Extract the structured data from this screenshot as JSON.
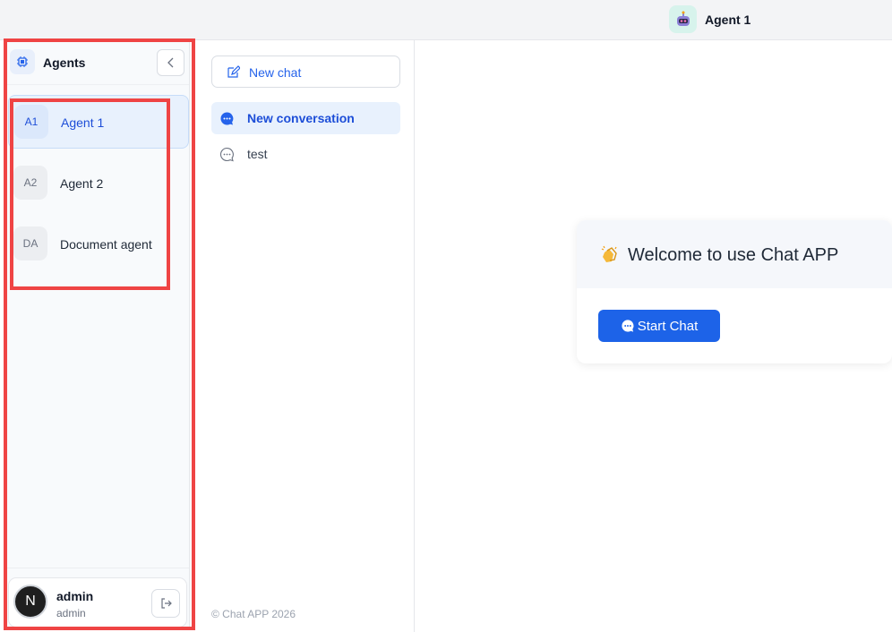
{
  "header": {
    "agent_name": "Agent 1",
    "agent_icon": "robot-icon"
  },
  "sidebar": {
    "title": "Agents",
    "logo_icon": "chip-icon",
    "collapse_icon": "chevron-left-icon",
    "agents": [
      {
        "badge": "A1",
        "name": "Agent 1",
        "active": true
      },
      {
        "badge": "A2",
        "name": "Agent 2",
        "active": false
      },
      {
        "badge": "DA",
        "name": "Document agent",
        "active": false
      }
    ],
    "user": {
      "avatar_letter": "N",
      "name": "admin",
      "role": "admin",
      "logout_icon": "logout-icon"
    }
  },
  "conversations": {
    "new_chat_label": "New chat",
    "new_chat_icon": "edit-icon",
    "items": [
      {
        "label": "New conversation",
        "active": true,
        "icon": "chat-bubble-icon"
      },
      {
        "label": "test",
        "active": false,
        "icon": "chat-bubble-outline-icon"
      }
    ],
    "copyright": "© Chat APP 2026"
  },
  "main": {
    "welcome_emoji": "👏",
    "welcome_title": "Welcome to use Chat APP",
    "start_label": "Start Chat",
    "start_icon": "chat-bubble-icon"
  },
  "colors": {
    "accent": "#1d63e8",
    "active_bg": "#e8f1fd",
    "highlight": "#ef4444"
  }
}
